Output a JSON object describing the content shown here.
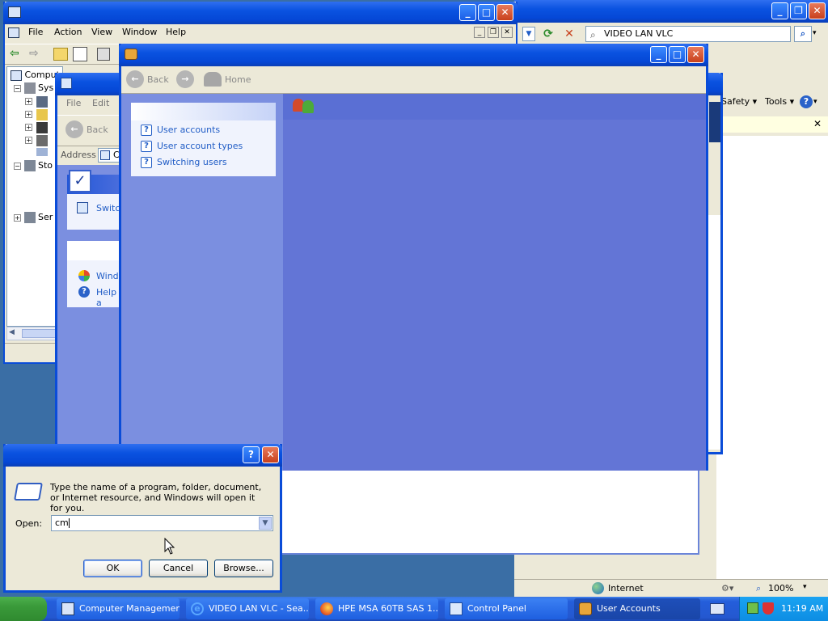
{
  "colors": {
    "desktop": "#3a6ea5",
    "xp_blue": "#0a4cd8",
    "cp_bg": "#6375d6",
    "taskbar": "#245edb",
    "start": "#3c9a3c"
  },
  "cm_window": {
    "menu": [
      "File",
      "Action",
      "View",
      "Window",
      "Help"
    ],
    "tree": [
      "Comput",
      "Sys",
      "Sto",
      "Ser"
    ]
  },
  "ie_window": {
    "search_text": "VIDEO LAN VLC",
    "tools": [
      "Safety ▾",
      "Tools ▾"
    ]
  },
  "cp_window": {
    "menu": [
      "File",
      "Edit"
    ],
    "back": "Back",
    "address": "Address",
    "address_short": "C",
    "left_items": [
      "Switch"
    ],
    "help_items": [
      "Windo",
      "Help a"
    ]
  },
  "ua_window": {
    "back": "Back",
    "home": "Home",
    "links": [
      "User accounts",
      "User account types",
      "Switching users"
    ]
  },
  "run_dialog": {
    "help_btn": "?",
    "desc": "Type the name of a program, folder, document, or Internet resource, and Windows will open it for you.",
    "open_label": "Open:",
    "open_value": "cm",
    "ok": "OK",
    "cancel": "Cancel",
    "browse": "Browse..."
  },
  "ie_status": {
    "zone": "Internet",
    "zoom": "100%"
  },
  "taskbar": {
    "items": [
      "Computer Management",
      "VIDEO LAN VLC - Sea...",
      "HPE MSA 60TB SAS 1...",
      "Control Panel",
      "User Accounts"
    ],
    "clock": "11:19 AM"
  }
}
